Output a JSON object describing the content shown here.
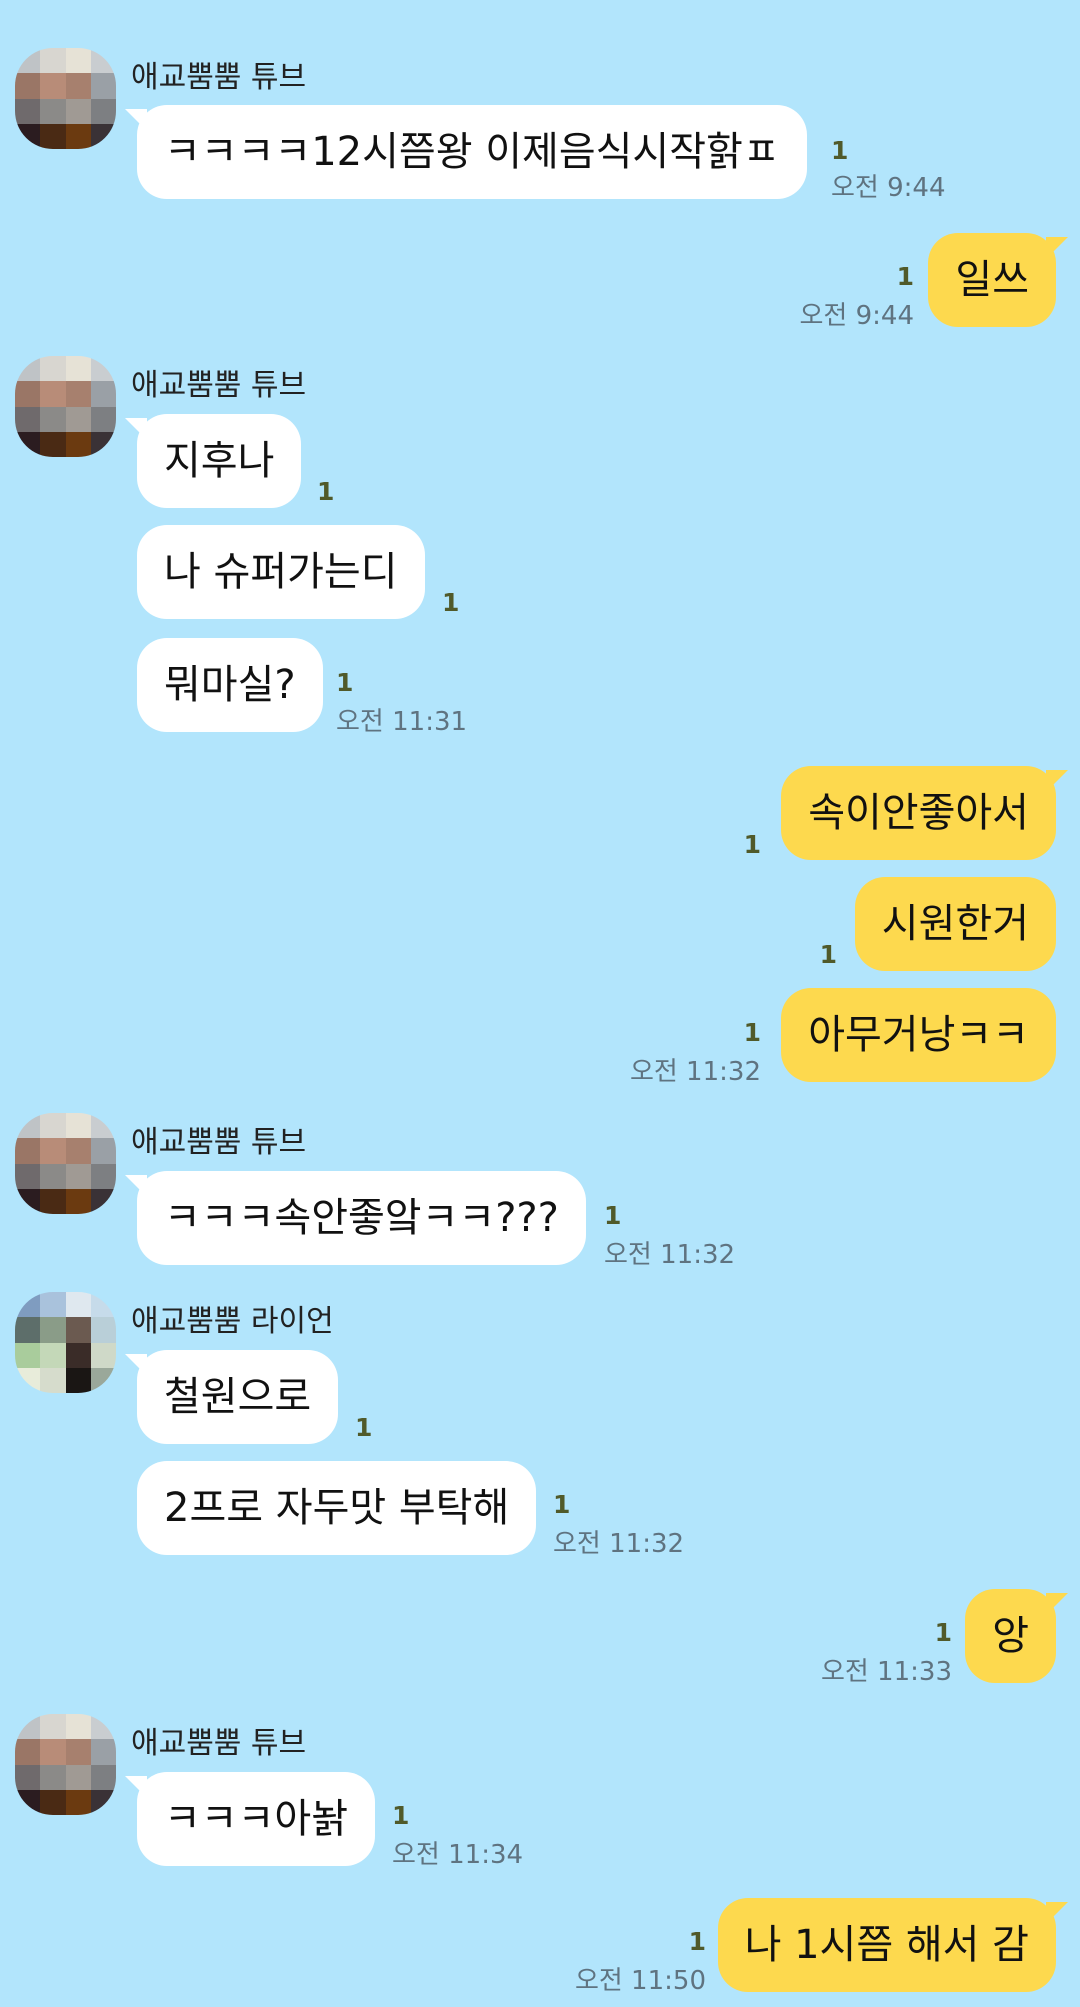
{
  "colors": {
    "background": "#b2e5fc",
    "incoming_bubble": "#ffffff",
    "outgoing_bubble": "#fdd94e",
    "unread": "#505a2a",
    "time": "#5f7380"
  },
  "senders": {
    "tube": "애교뿜뿜 튜브",
    "lion": "애교뿜뿜 라이언"
  },
  "messages": [
    {
      "text": "ㅋㅋㅋㅋ12시쯤왕 이제음식시작핡ㅍ",
      "unread": "1",
      "time": "오전 9:44"
    },
    {
      "text": "일쓰",
      "unread": "1",
      "time": "오전 9:44"
    },
    {
      "text": "지후나",
      "unread": "1"
    },
    {
      "text": "나 슈퍼가는디",
      "unread": "1"
    },
    {
      "text": "뭐마실?",
      "unread": "1",
      "time": "오전 11:31"
    },
    {
      "text": "속이안좋아서",
      "unread": "1"
    },
    {
      "text": "시원한거",
      "unread": "1"
    },
    {
      "text": "아무거낭ㅋㅋ",
      "unread": "1",
      "time": "오전 11:32"
    },
    {
      "text": "ㅋㅋㅋ속안좋앜ㅋㅋ???",
      "unread": "1",
      "time": "오전 11:32"
    },
    {
      "text": "철원으로",
      "unread": "1"
    },
    {
      "text": "2프로 자두맛 부탁해",
      "unread": "1",
      "time": "오전 11:32"
    },
    {
      "text": "앙",
      "unread": "1",
      "time": "오전 11:33"
    },
    {
      "text": "ㅋㅋㅋ아놝",
      "unread": "1",
      "time": "오전 11:34"
    },
    {
      "text": "나 1시쯤 해서 감",
      "unread": "1",
      "time": "오전 11:50"
    }
  ]
}
